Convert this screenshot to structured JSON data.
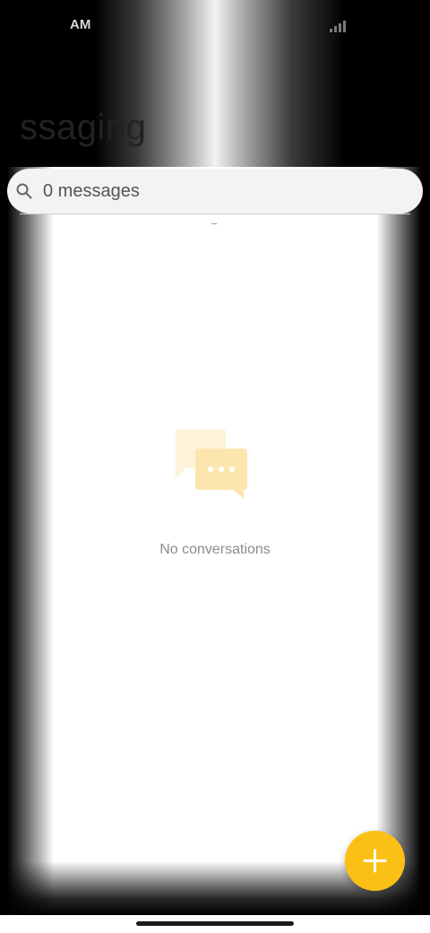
{
  "status_bar": {
    "time": "AM",
    "signal_icon": "signal-icon"
  },
  "header": {
    "title": "ssaging"
  },
  "search": {
    "value": "0 messages",
    "icon": "search-icon"
  },
  "empty_state": {
    "icon": "chat-bubbles-icon",
    "label": "No conversations"
  },
  "fab": {
    "icon": "plus-icon",
    "color": "#fbc016"
  },
  "colors": {
    "accent": "#fbc016",
    "bubble_light": "#fef3da",
    "bubble_dark": "#fde6ae"
  }
}
